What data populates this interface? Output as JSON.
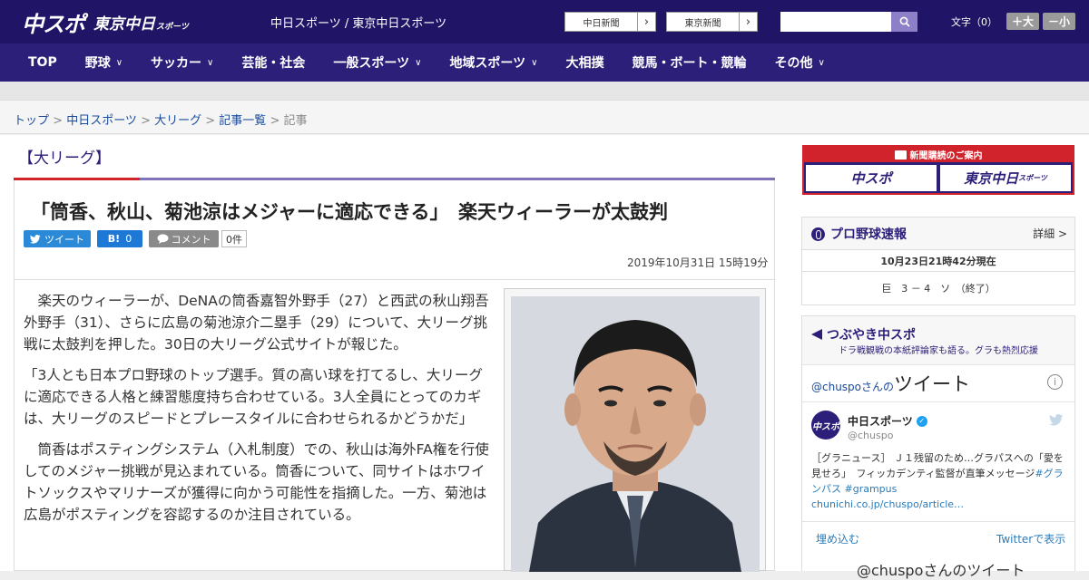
{
  "header": {
    "logo_main": "中スポ",
    "logo_tokyo": "東京中日",
    "logo_tokyo_sub": "スポーツ",
    "site_links": "中日スポーツ / 東京中日スポーツ",
    "paper_btn_1": "中日新聞",
    "paper_btn_2": "東京新聞",
    "search_placeholder": "",
    "font_size_label": "文字（0）",
    "font_bigger": "＋大",
    "font_smaller": "－小"
  },
  "nav": {
    "items": [
      {
        "label": "TOP",
        "dropdown": false
      },
      {
        "label": "野球",
        "dropdown": true
      },
      {
        "label": "サッカー",
        "dropdown": true
      },
      {
        "label": "芸能・社会",
        "dropdown": false
      },
      {
        "label": "一般スポーツ",
        "dropdown": true
      },
      {
        "label": "地域スポーツ",
        "dropdown": true
      },
      {
        "label": "大相撲",
        "dropdown": false
      },
      {
        "label": "競馬・ボート・競輪",
        "dropdown": false
      },
      {
        "label": "その他",
        "dropdown": true
      }
    ]
  },
  "breadcrumb": {
    "items": [
      "トップ",
      "中日スポーツ",
      "大リーグ",
      "記事一覧"
    ],
    "current": "記事",
    "separator": " > "
  },
  "article": {
    "section": "【大リーグ】",
    "headline": "「筒香、秋山、菊池涼はメジャーに適応できる」　楽天ウィーラーが太鼓判",
    "share": {
      "tweet": "ツイート",
      "hatena": "B!",
      "hatena_count": "0",
      "comment": "コメント",
      "comment_count": "0件"
    },
    "date": "2019年10月31日 15時19分",
    "paragraphs": [
      "　楽天のウィーラーが、DeNAの筒香嘉智外野手（27）と西武の秋山翔吾外野手（31）、さらに広島の菊池涼介二塁手（29）について、大リーグ挑戦に太鼓判を押した。30日の大リーグ公式サイトが報じた。",
      "「3人とも日本プロ野球のトップ選手。質の高い球を打てるし、大リーグに適応できる人格と練習態度持ち合わせている。3人全員にとってのカギは、大リーグのスピードとプレースタイルに合わせられるかどうかだ」",
      "　筒香はポスティングシステム（入札制度）での、秋山は海外FA権を行使してのメジャー挑戦が見込まれている。筒香について、同サイトはホワイトソックスやマリナーズが獲得に向かう可能性を指摘した。一方、菊池は広島がポスティングを容認するのか注目されている。"
    ]
  },
  "sidebar": {
    "subscribe": {
      "title": "新聞購読のご案内",
      "logo_1": "中スポ",
      "logo_2": "東京中日",
      "logo_2_sub": "スポーツ"
    },
    "pro_baseball": {
      "title": "プロ野球速報",
      "detail": "詳細 >",
      "updated": "10月23日21時42分現在",
      "score": "巨　3 － 4　ソ　（終了）"
    },
    "tsubuyaki": {
      "title": "つぶやき中スポ",
      "subtitle": "ドラ戦観戦の本紙評論家も語る。グラも熱烈応援"
    },
    "twitter": {
      "title_prefix": "@chuspo",
      "title_mid": "さんの",
      "title_big": "ツイート",
      "avatar_text": "中スポ",
      "name": "中日スポーツ",
      "handle": "@chuspo",
      "text_1": "［グラニュース］ Ｊ１残留のため…グラパスへの「愛を見せろ」　フィッカデンティ監督が直筆メッセージ",
      "tag_1": "#グランパス",
      "tag_2": "#grampus",
      "link": "chunichi.co.jp/chuspo/article…",
      "embed": "埋め込む",
      "view_on_twitter": "Twitterで表示",
      "bottom_text": "@chuspoさんのツイート"
    }
  },
  "colors": {
    "header_bg": "#1f1466",
    "nav_bg": "#2b1f7a",
    "accent_red": "#d0232b",
    "accent_purple": "#8273b8"
  }
}
